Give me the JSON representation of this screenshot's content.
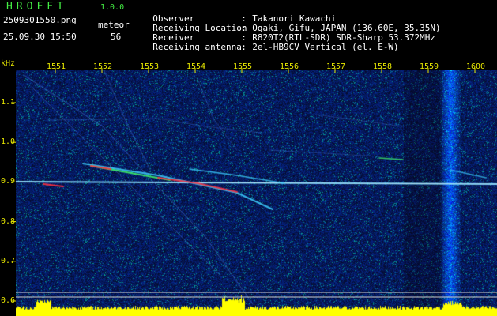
{
  "header": {
    "app_name": "HROFFT",
    "app_version": "1.0.0",
    "file_name": "2509301550.png",
    "meteor_label": "meteor",
    "timestamp": "25.09.30 15:50",
    "meteor_count": "56"
  },
  "info": [
    {
      "key": "Observer",
      "sep": ":",
      "value": "Takanori Kawachi"
    },
    {
      "key": "Receiving Location",
      "sep": ":",
      "value": "Ogaki, Gifu, JAPAN (136.60E, 35.35N)"
    },
    {
      "key": "Receiver",
      "sep": ":",
      "value": "R820T2(RTL-SDR) SDR-Sharp 53.372MHz"
    },
    {
      "key": "Receiving antenna",
      "sep": ":",
      "value": "2el-HB9CV Vertical (el. E-W)"
    }
  ],
  "axis": {
    "y_unit": "kHz",
    "time_ticks": [
      "1551",
      "1552",
      "1553",
      "1554",
      "1555",
      "1556",
      "1557",
      "1558",
      "1559",
      "1600"
    ],
    "freq_ticks": [
      "1.1",
      "1.0",
      "0.9",
      "0.8",
      "0.7",
      "0.6"
    ]
  },
  "colors": {
    "noise_blue": "#1a2a9a",
    "carrier": "#6fd8ff",
    "meteor_red": "#ff3040",
    "label_yellow": "#e8e800",
    "header_green": "#44ee44",
    "noise_bar": "#ffff00"
  }
}
